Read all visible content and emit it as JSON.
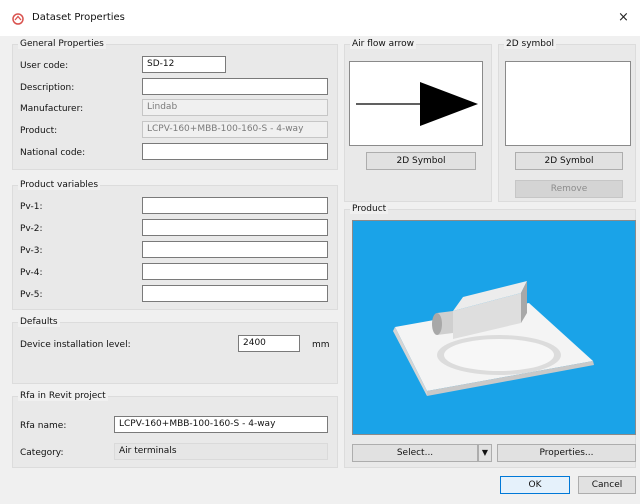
{
  "window": {
    "title": "Dataset Properties",
    "close_symbol": "×"
  },
  "general": {
    "header": "General Properties",
    "user_code_label": "User code:",
    "user_code_value": "SD-12",
    "description_label": "Description:",
    "description_value": "",
    "manufacturer_label": "Manufacturer:",
    "manufacturer_value": "Lindab",
    "product_label": "Product:",
    "product_value": "LCPV-160+MBB-100-160-S - 4-way",
    "national_code_label": "National code:",
    "national_code_value": ""
  },
  "variables": {
    "header": "Product variables",
    "items": [
      {
        "label": "Pv-1:",
        "value": ""
      },
      {
        "label": "Pv-2:",
        "value": ""
      },
      {
        "label": "Pv-3:",
        "value": ""
      },
      {
        "label": "Pv-4:",
        "value": ""
      },
      {
        "label": "Pv-5:",
        "value": ""
      }
    ]
  },
  "defaults": {
    "header": "Defaults",
    "device_level_label": "Device installation level:",
    "device_level_value": "2400",
    "unit": "mm"
  },
  "rfa": {
    "header": "Rfa in Revit project",
    "name_label": "Rfa name:",
    "name_value": "LCPV-160+MBB-100-160-S - 4-way",
    "category_label": "Category:",
    "category_value": "Air terminals"
  },
  "air_flow": {
    "header": "Air flow arrow",
    "button": "2D Symbol"
  },
  "symbol2d": {
    "header": "2D symbol",
    "button": "2D Symbol",
    "remove_button": "Remove"
  },
  "product_view": {
    "header": "Product",
    "select_button": "Select...",
    "properties_button": "Properties...",
    "dropdown_symbol": "▼"
  },
  "footer": {
    "ok": "OK",
    "cancel": "Cancel"
  },
  "colors": {
    "product_background": "#1aa3e8",
    "ok_border": "#0078d7"
  }
}
